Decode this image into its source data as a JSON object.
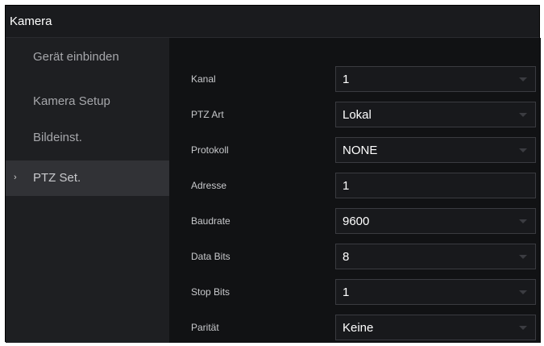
{
  "window": {
    "title": "Kamera"
  },
  "sidebar": {
    "items": [
      {
        "label": "Gerät einbinden",
        "active": false
      },
      {
        "label": "Kamera Setup",
        "active": false
      },
      {
        "label": "Bildeinst.",
        "active": false
      },
      {
        "label": "PTZ Set.",
        "active": true
      }
    ],
    "active_marker": "›"
  },
  "form": {
    "fields": [
      {
        "label": "Kanal",
        "value": "1",
        "type": "select"
      },
      {
        "label": "PTZ Art",
        "value": "Lokal",
        "type": "select"
      },
      {
        "label": "Protokoll",
        "value": "NONE",
        "type": "select"
      },
      {
        "label": "Adresse",
        "value": "1",
        "type": "input"
      },
      {
        "label": "Baudrate",
        "value": "9600",
        "type": "select"
      },
      {
        "label": "Data Bits",
        "value": "8",
        "type": "select"
      },
      {
        "label": "Stop Bits",
        "value": "1",
        "type": "select"
      },
      {
        "label": "Parität",
        "value": "Keine",
        "type": "select"
      }
    ]
  },
  "colors": {
    "background": "#111214",
    "sidebar": "#1e1f22",
    "sidebar_active": "#313236",
    "field_border": "#3a3b40"
  }
}
